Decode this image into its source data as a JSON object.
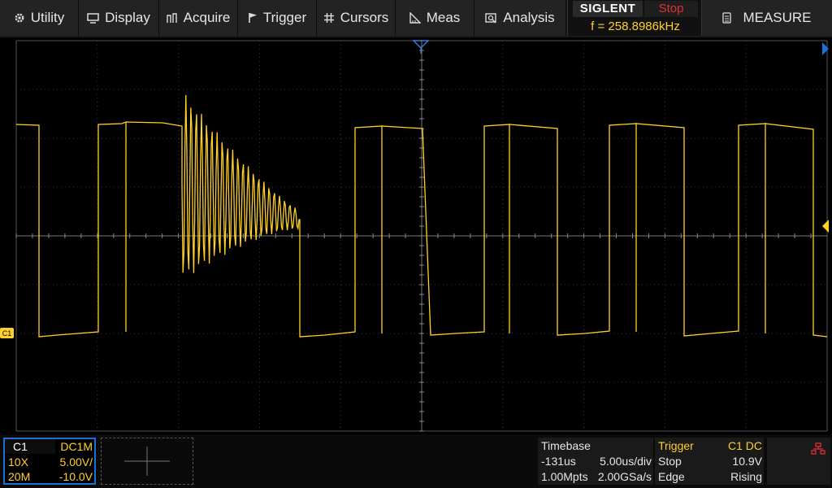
{
  "menu": [
    {
      "id": "utility",
      "label": "Utility",
      "icon": "gear-icon"
    },
    {
      "id": "display",
      "label": "Display",
      "icon": "monitor-icon"
    },
    {
      "id": "acquire",
      "label": "Acquire",
      "icon": "acquire-icon"
    },
    {
      "id": "trigger",
      "label": "Trigger",
      "icon": "flag-icon"
    },
    {
      "id": "cursors",
      "label": "Cursors",
      "icon": "cursor-grid-icon"
    },
    {
      "id": "meas",
      "label": "Meas",
      "icon": "ruler-icon"
    },
    {
      "id": "analysis",
      "label": "Analysis",
      "icon": "analysis-icon"
    }
  ],
  "brand": {
    "logo": "SIGLENT",
    "run_state": "Stop",
    "frequency": "f = 258.8986kHz"
  },
  "measure_button": {
    "label": "MEASURE",
    "icon": "measure-icon"
  },
  "channel1": {
    "name": "C1",
    "coupling": "DC1M",
    "probe": "10X",
    "volts_div": "5.00V/",
    "bandwidth": "20M",
    "offset": "-10.0V",
    "marker": "C1",
    "color": "#ffd02a"
  },
  "timebase": {
    "title": "Timebase",
    "delay": "-131us",
    "time_div": "5.00us/div",
    "memory": "1.00Mpts",
    "sample_rate": "2.00GSa/s"
  },
  "trigger": {
    "title": "Trigger",
    "source": "C1 DC",
    "state": "Stop",
    "level": "10.9V",
    "type": "Edge",
    "slope": "Rising"
  },
  "network_icon": "network-icon",
  "colors": {
    "trace": "#ffd02a",
    "accent": "#1d6fd6",
    "stop": "#e03030"
  }
}
